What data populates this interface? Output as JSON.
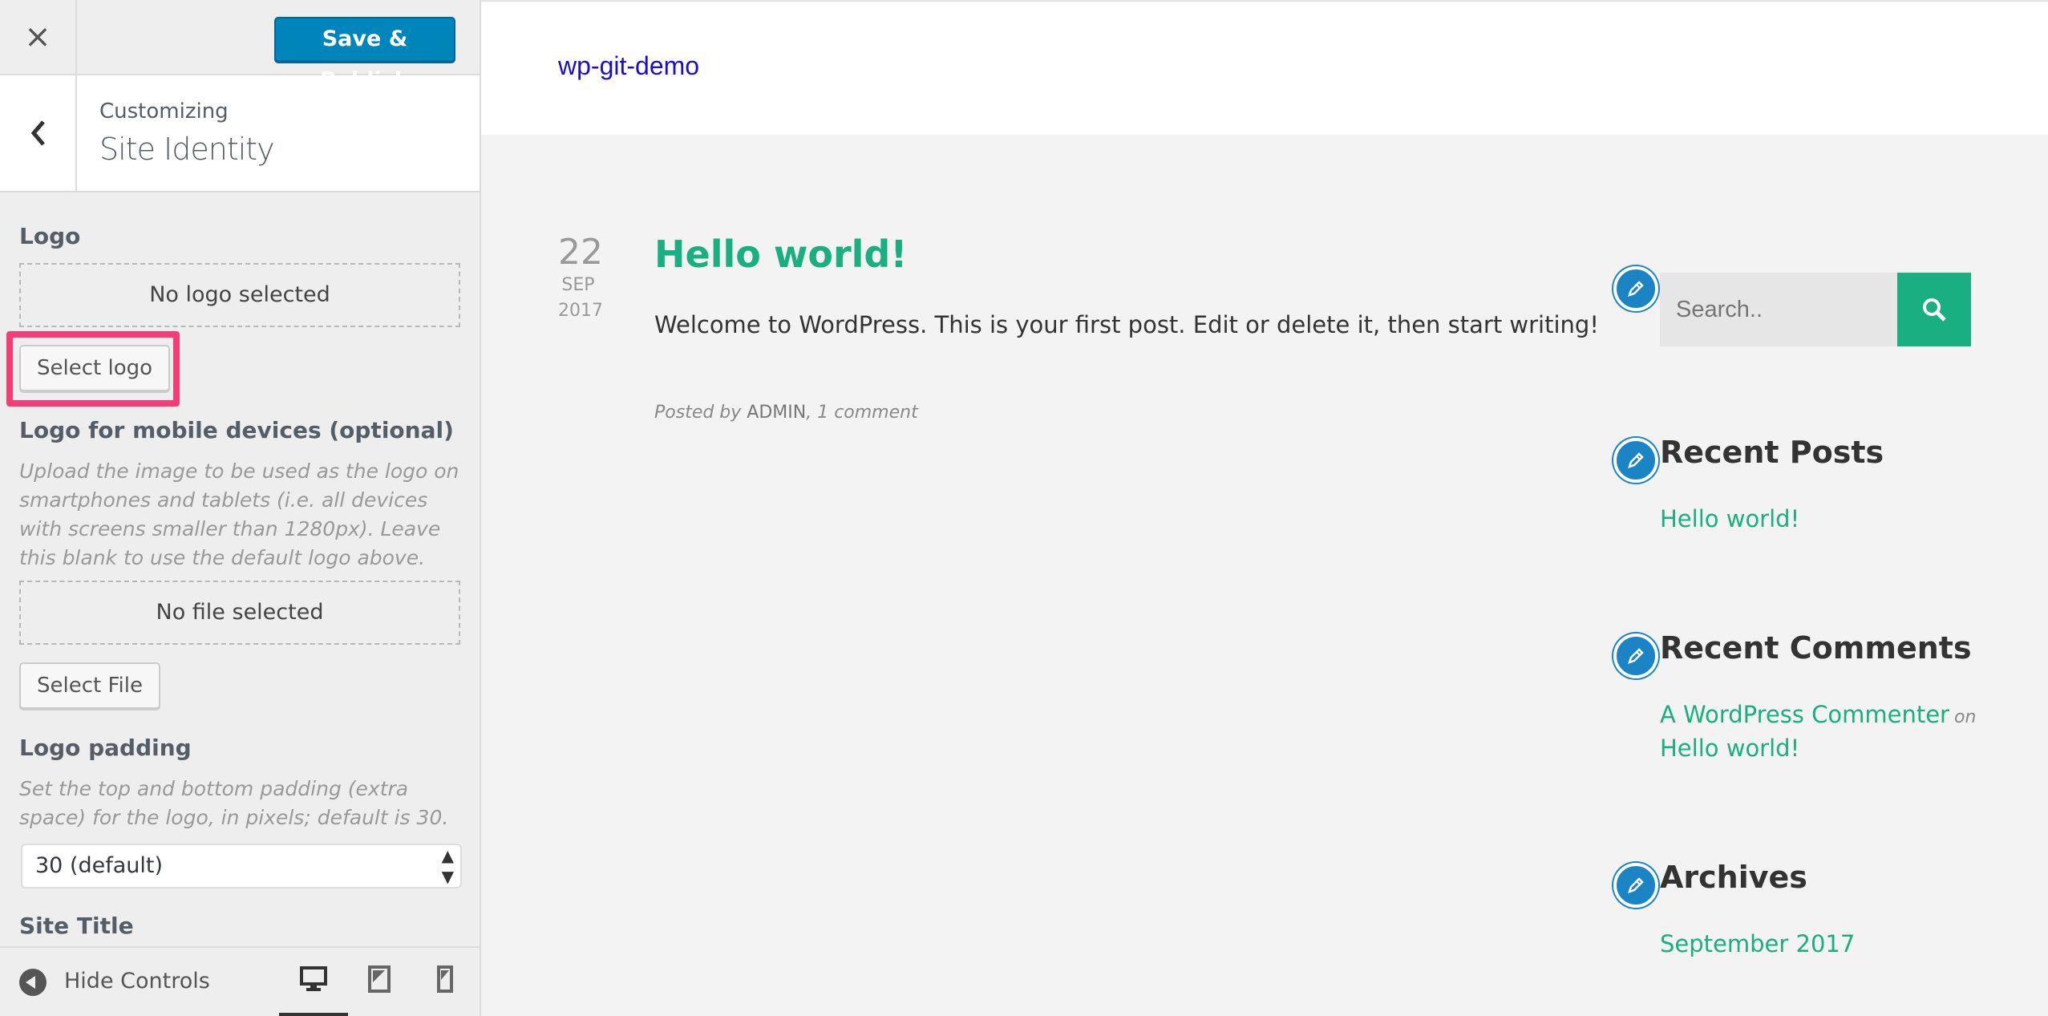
{
  "customizer": {
    "close_label": "×",
    "publish_label": "Save & Publish",
    "crumb": "Customizing",
    "section_title": "Site Identity",
    "logo": {
      "title": "Logo",
      "placeholder": "No logo selected",
      "button": "Select logo"
    },
    "mobile_logo": {
      "title": "Logo for mobile devices (optional)",
      "description": "Upload the image to be used as the logo on smartphones and tablets (i.e. all devices with screens smaller than 1280px). Leave this blank to use the default logo above.",
      "placeholder": "No file selected",
      "button": "Select File"
    },
    "logo_padding": {
      "title": "Logo padding",
      "description": "Set the top and bottom padding (extra space) for the logo, in pixels; default is 30.",
      "selected": "30 (default)"
    },
    "site_title_label": "Site Title",
    "footer": {
      "hide_controls": "Hide Controls",
      "active_device": "desktop"
    },
    "highlight_color": "#f43d76",
    "accent_color": "#0085ba"
  },
  "preview": {
    "site_title": "wp-git-demo",
    "post": {
      "day": "22",
      "month": "SEP",
      "year": "2017",
      "title": "Hello world!",
      "excerpt": "Welcome to WordPress. This is your first post. Edit or delete it, then start writing!",
      "meta_prefix": "Posted by",
      "author": "ADMIN",
      "comments": ", 1 comment"
    },
    "search_placeholder": "Search..",
    "widgets": {
      "recent_posts": {
        "title": "Recent Posts",
        "items": [
          "Hello world!"
        ]
      },
      "recent_comments": {
        "title": "Recent Comments",
        "author": "A WordPress Commenter",
        "on": "on",
        "post": "Hello world!"
      },
      "archives": {
        "title": "Archives",
        "items": [
          "September 2017"
        ]
      }
    },
    "accent_color": "#1aaf80",
    "icon_color": "#1b84c5"
  }
}
